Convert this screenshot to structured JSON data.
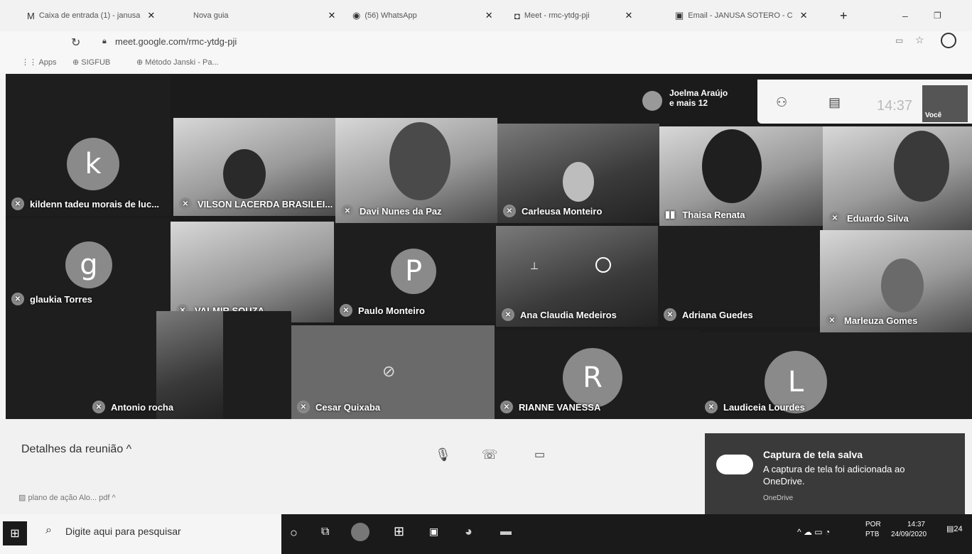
{
  "browser": {
    "tabs": [
      {
        "label": "Caixa de entrada (1) - janusa",
        "icon": "gmail-icon"
      },
      {
        "label": "Nova guia",
        "icon": ""
      },
      {
        "label": "(56) WhatsApp",
        "icon": "whatsapp-icon"
      },
      {
        "label": "Meet - rmc-ytdg-pji",
        "icon": "meet-icon"
      },
      {
        "label": "Email - JANUSA SOTERO - C",
        "icon": "outlook-icon"
      }
    ],
    "address": "meet.google.com/rmc-ytdg-pji",
    "bookmarks": [
      {
        "label": "Apps"
      },
      {
        "label": "SIGFUB"
      },
      {
        "label": "Método Janski - Pa..."
      }
    ]
  },
  "meet": {
    "header": {
      "joelma_line1": "Joelma Araújo",
      "joelma_line2": "e mais 12",
      "time": "14:37",
      "self_label": "Você"
    },
    "participants": [
      {
        "name": "kildenn tadeu morais de luc...",
        "initial": "k"
      },
      {
        "name": "VILSON LACERDA BRASILEI..."
      },
      {
        "name": "Davi Nunes da Paz"
      },
      {
        "name": "Carleusa Monteiro"
      },
      {
        "name": "Thaisa Renata"
      },
      {
        "name": "Eduardo Silva"
      },
      {
        "name": "glaukia Torres",
        "initial": "g"
      },
      {
        "name": "VALMIR SOUZA"
      },
      {
        "name": "Paulo Monteiro",
        "initial": "P"
      },
      {
        "name": "Ana Claudia Medeiros"
      },
      {
        "name": "Adriana Guedes"
      },
      {
        "name": "Marleuza Gomes"
      },
      {
        "name": "Antonio rocha"
      },
      {
        "name": "Cesar Quixaba"
      },
      {
        "name": "RIANNE VANESSA",
        "initial": "R"
      },
      {
        "name": "Laudiceia Lourdes",
        "initial": "L"
      }
    ]
  },
  "controls": {
    "details": "Detalhes da reunião",
    "download": "plano de ação Alo... pdf"
  },
  "toast": {
    "title": "Captura de tela salva",
    "body": "A captura de tela foi adicionada ao OneDrive.",
    "source": "OneDrive"
  },
  "taskbar": {
    "search_placeholder": "Digite aqui para pesquisar",
    "lang1": "POR",
    "lang2": "PTB",
    "time": "14:37",
    "date": "24/09/2020",
    "notif_count": "24"
  }
}
